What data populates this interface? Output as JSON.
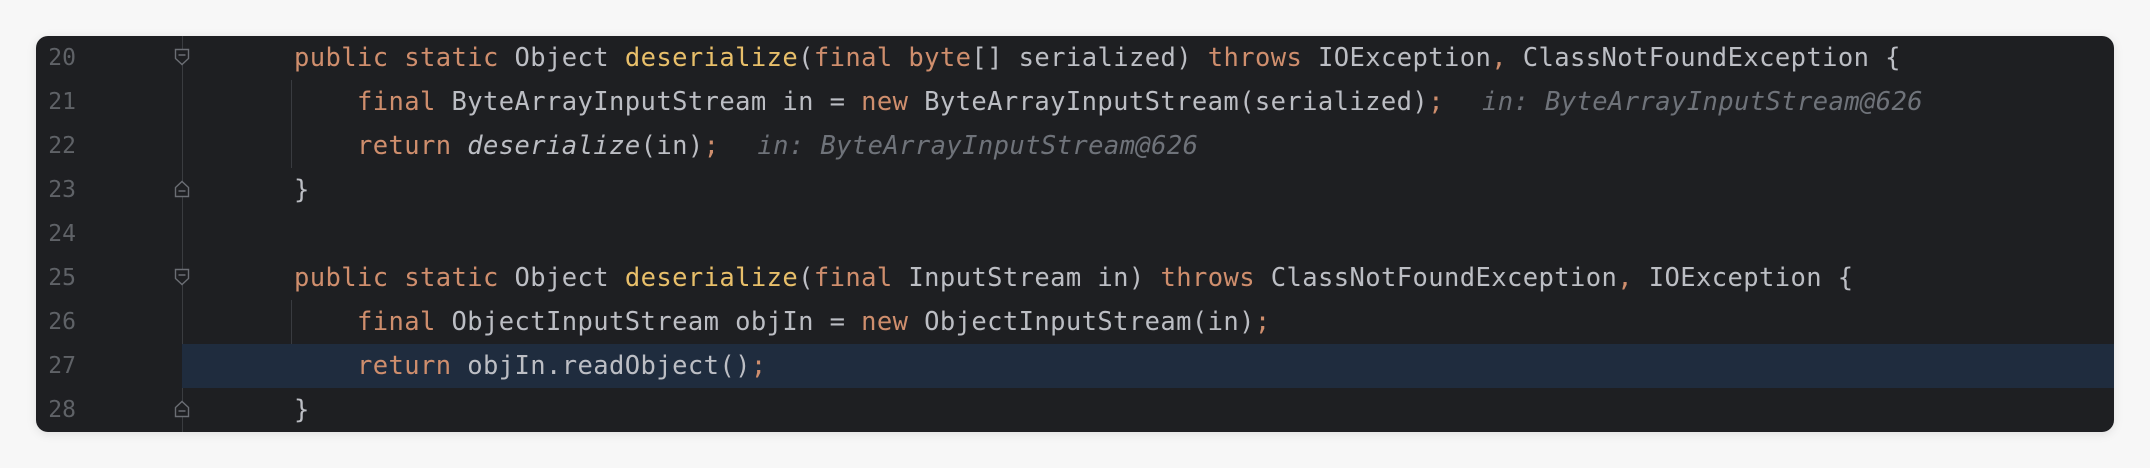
{
  "editor": {
    "lines": [
      {
        "number": "20",
        "fold": "start",
        "tokens": [
          {
            "t": "public",
            "c": "kw"
          },
          {
            "t": " ",
            "c": "pl"
          },
          {
            "t": "static",
            "c": "kw"
          },
          {
            "t": " Object ",
            "c": "pl"
          },
          {
            "t": "deserialize",
            "c": "fnd"
          },
          {
            "t": "(",
            "c": "pl"
          },
          {
            "t": "final",
            "c": "kw"
          },
          {
            "t": " ",
            "c": "pl"
          },
          {
            "t": "byte",
            "c": "kw"
          },
          {
            "t": "[] serialized) ",
            "c": "pl"
          },
          {
            "t": "throws",
            "c": "kw"
          },
          {
            "t": " IOException",
            "c": "pl"
          },
          {
            "t": ",",
            "c": "kw"
          },
          {
            "t": " ClassNotFoundException {",
            "c": "pl"
          }
        ],
        "hint": ""
      },
      {
        "number": "21",
        "fold": "",
        "tokens": [
          {
            "t": "    ",
            "c": "pl"
          },
          {
            "t": "final",
            "c": "kw"
          },
          {
            "t": " ByteArrayInputStream in = ",
            "c": "pl"
          },
          {
            "t": "new",
            "c": "kw"
          },
          {
            "t": " ByteArrayInputStream(serialized)",
            "c": "pl"
          },
          {
            "t": ";",
            "c": "kw"
          }
        ],
        "hint": "in: ByteArrayInputStream@626"
      },
      {
        "number": "22",
        "fold": "",
        "tokens": [
          {
            "t": "    ",
            "c": "pl"
          },
          {
            "t": "return",
            "c": "kw"
          },
          {
            "t": " ",
            "c": "pl"
          },
          {
            "t": "deserialize",
            "c": "pl it"
          },
          {
            "t": "(in)",
            "c": "pl"
          },
          {
            "t": ";",
            "c": "kw"
          }
        ],
        "hint": "in: ByteArrayInputStream@626"
      },
      {
        "number": "23",
        "fold": "end",
        "tokens": [
          {
            "t": "}",
            "c": "pl"
          }
        ],
        "hint": ""
      },
      {
        "number": "24",
        "fold": "",
        "tokens": [],
        "hint": ""
      },
      {
        "number": "25",
        "fold": "start",
        "tokens": [
          {
            "t": "public",
            "c": "kw"
          },
          {
            "t": " ",
            "c": "pl"
          },
          {
            "t": "static",
            "c": "kw"
          },
          {
            "t": " Object ",
            "c": "pl"
          },
          {
            "t": "deserialize",
            "c": "fnd"
          },
          {
            "t": "(",
            "c": "pl"
          },
          {
            "t": "final",
            "c": "kw"
          },
          {
            "t": " InputStream in) ",
            "c": "pl"
          },
          {
            "t": "throws",
            "c": "kw"
          },
          {
            "t": " ClassNotFoundException",
            "c": "pl"
          },
          {
            "t": ",",
            "c": "kw"
          },
          {
            "t": " IOException {",
            "c": "pl"
          }
        ],
        "hint": ""
      },
      {
        "number": "26",
        "fold": "",
        "tokens": [
          {
            "t": "    ",
            "c": "pl"
          },
          {
            "t": "final",
            "c": "kw"
          },
          {
            "t": " ObjectInputStream objIn = ",
            "c": "pl"
          },
          {
            "t": "new",
            "c": "kw"
          },
          {
            "t": " ObjectInputStream(in)",
            "c": "pl"
          },
          {
            "t": ";",
            "c": "kw"
          }
        ],
        "hint": ""
      },
      {
        "number": "27",
        "fold": "",
        "current": true,
        "tokens": [
          {
            "t": "    ",
            "c": "pl"
          },
          {
            "t": "return",
            "c": "kw"
          },
          {
            "t": " objIn.readObject()",
            "c": "pl"
          },
          {
            "t": ";",
            "c": "kw"
          }
        ],
        "hint": ""
      },
      {
        "number": "28",
        "fold": "end",
        "tokens": [
          {
            "t": "}",
            "c": "pl"
          }
        ],
        "hint": ""
      }
    ]
  },
  "colors": {
    "background": "#1e1f22",
    "keyword": "#cf8e6d",
    "method_declaration": "#e8bf6a",
    "plain": "#bcbec4",
    "inlay_hint": "#6f737a",
    "line_number": "#5f6267",
    "current_line": "#1f2c3e"
  }
}
